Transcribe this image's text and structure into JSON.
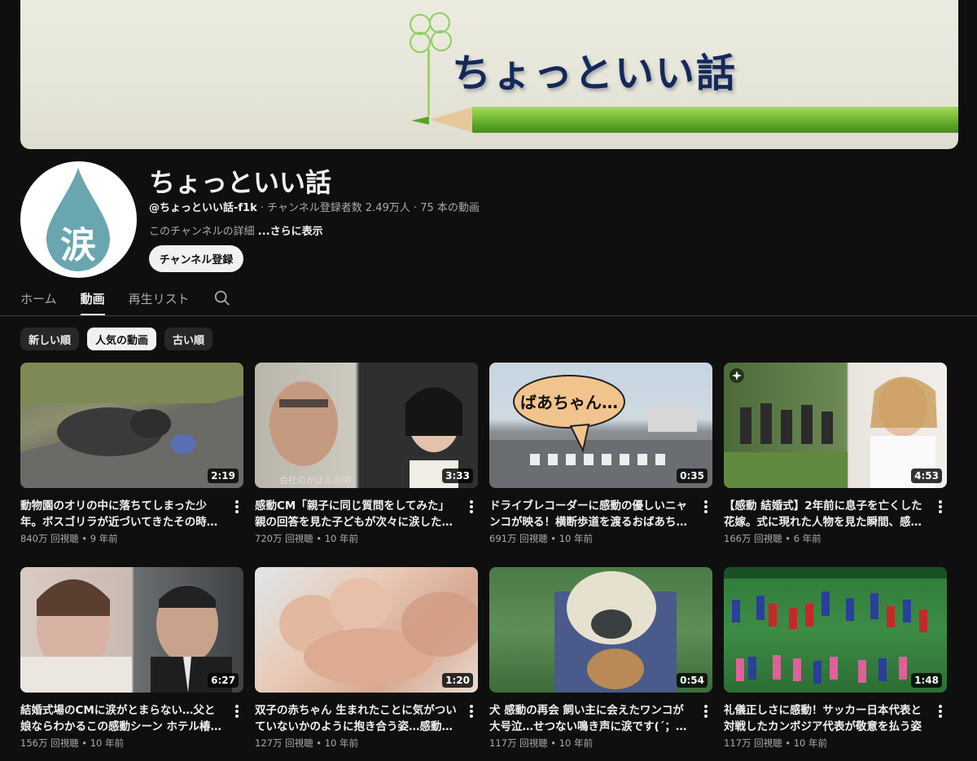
{
  "banner": {
    "title": "ちょっといい話"
  },
  "channel": {
    "avatar_text": "涙",
    "name": "ちょっといい話",
    "handle": "@ちょっといい話-f1k",
    "meta": " · チャンネル登録者数 2.49万人 · 75 本の動画",
    "description": "このチャンネルの詳細 ",
    "description_more": "...さらに表示",
    "subscribe_label": "チャンネル登録"
  },
  "tabs": [
    {
      "label": "ホーム",
      "active": false
    },
    {
      "label": "動画",
      "active": true
    },
    {
      "label": "再生リスト",
      "active": false
    }
  ],
  "chips": [
    {
      "label": "新しい順",
      "active": false
    },
    {
      "label": "人気の動画",
      "active": true
    },
    {
      "label": "古い順",
      "active": false
    }
  ],
  "videos": [
    {
      "title": "動物園のオリの中に落ちてしまった少年。ボスゴリラが近づいてきたその時…",
      "duration": "2:19",
      "stats": "840万 回視聴 • 9 年前"
    },
    {
      "title": "感動CM「親子に同じ質問をしてみた」親の回答を見た子どもが次々に涙した理由とは…",
      "duration": "3:33",
      "stats": "720万 回視聴 • 10 年前",
      "caption": "会社のかばんの中"
    },
    {
      "title": "ドライブレコーダーに感動の優しいニャンコが映る！横断歩道を渡るおばあちゃんを気…",
      "duration": "0:35",
      "stats": "691万 回視聴 • 10 年前",
      "bubble": "ばあちゃん…"
    },
    {
      "title": "【感動 結婚式】2年前に息子を亡くした花嫁。式に現れた人物を見た瞬間、感極まる",
      "duration": "4:53",
      "stats": "166万 回視聴 • 6 年前"
    },
    {
      "title": "結婚式場のCMに涙がとまらない…父と娘ならわかるこの感動シーン ホテル椿山荘東京…",
      "duration": "6:27",
      "stats": "156万 回視聴 • 10 年前"
    },
    {
      "title": "双子の赤ちゃん 生まれたことに気がついていないかのように抱き合う姿…感動的すぎ…",
      "duration": "1:20",
      "stats": "127万 回視聴 • 10 年前"
    },
    {
      "title": "犬 感動の再会 飼い主に会えたワンコが大号泣…せつない鳴き声に涙です(´；ω；`)",
      "duration": "0:54",
      "stats": "117万 回視聴 • 10 年前"
    },
    {
      "title": "礼儀正しさに感動！サッカー日本代表と対戦したカンボジア代表が敬意を払う姿",
      "duration": "1:48",
      "stats": "117万 回視聴 • 10 年前"
    }
  ],
  "colors": {
    "background": "#0f0f0f",
    "text_primary": "#f1f1f1",
    "text_secondary": "#aaaaaa",
    "chip_bg": "#272727",
    "banner_title": "#14285a",
    "avatar_drop": "#6aa6b0"
  }
}
